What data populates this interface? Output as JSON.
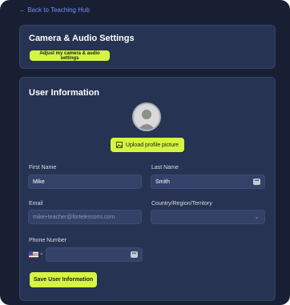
{
  "nav": {
    "back_label": "← Back to Teaching Hub"
  },
  "camera_card": {
    "title": "Camera & Audio Settings",
    "button_label": "Adjust my camera & audio settings"
  },
  "user_card": {
    "title": "User Information",
    "upload_label": "Upload profile picture",
    "first_name": {
      "label": "First Name",
      "value": "Mike"
    },
    "last_name": {
      "label": "Last Name",
      "value": "Smith"
    },
    "email": {
      "label": "Email",
      "value": "mike+teacher@fortelessons.com"
    },
    "country": {
      "label": "Country/Region/Territory",
      "value": ""
    },
    "phone": {
      "label": "Phone Number",
      "value": "",
      "country_flag": "us-flag-icon"
    },
    "save_label": "Save User Information"
  },
  "colors": {
    "background": "#181f33",
    "card": "#273352",
    "input": "#34426a",
    "accent": "#d5f542",
    "link": "#6e8fff"
  }
}
